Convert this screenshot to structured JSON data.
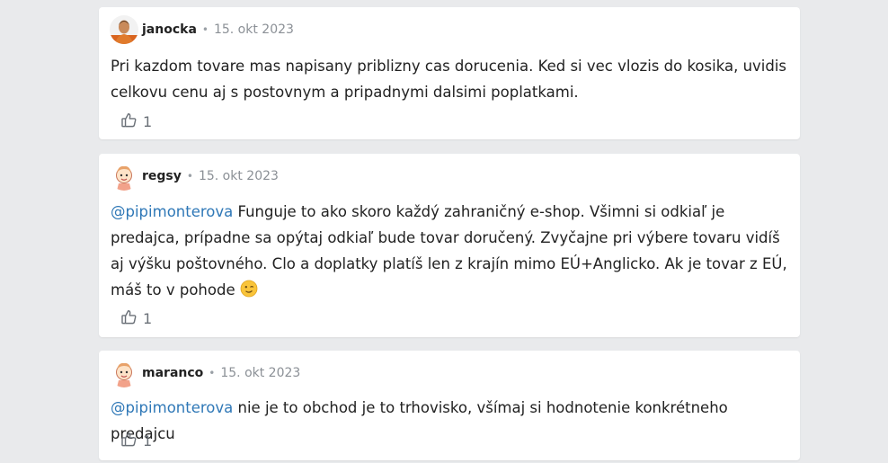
{
  "comments": [
    {
      "author": "janocka",
      "date": "15. okt 2023",
      "avatar_icon": "user-photo-avatar",
      "mention": "",
      "text": "Pri kazdom tovare mas napisany priblizny cas dorucenia. Ked si vec vlozis do kosika, uvidis celkovu cenu aj s postovnym a pripadnymi dalsimi poplatkami.",
      "likes": "1"
    },
    {
      "author": "regsy",
      "date": "15. okt 2023",
      "avatar_icon": "cartoon-child-avatar",
      "mention": "@pipimonterova",
      "text": " Funguje to ako skoro každý zahraničný e-shop. Všimni si odkiaľ je predajca, prípadne sa opýtaj odkiaľ bude tovar doručený. Zvyčajne pri výbere tovaru vidíš aj výšku poštovného. Clo a doplatky platíš len z krajín mimo EÚ+Anglicko. Ak je tovar z EÚ, máš to v pohode ",
      "emoji": "winking-face-emoji",
      "likes": "1"
    },
    {
      "author": "maranco",
      "date": "15. okt 2023",
      "avatar_icon": "cartoon-child-avatar",
      "mention": "@pipimonterova",
      "text": " nie je to obchod je to trhovisko, všímaj si hodnotenie konkrétneho predajcu",
      "likes": "1"
    }
  ],
  "separator": "•",
  "colors": {
    "background": "#e9eaec",
    "card": "#ffffff",
    "mention": "#2f78b7",
    "muted": "#8b9096"
  }
}
